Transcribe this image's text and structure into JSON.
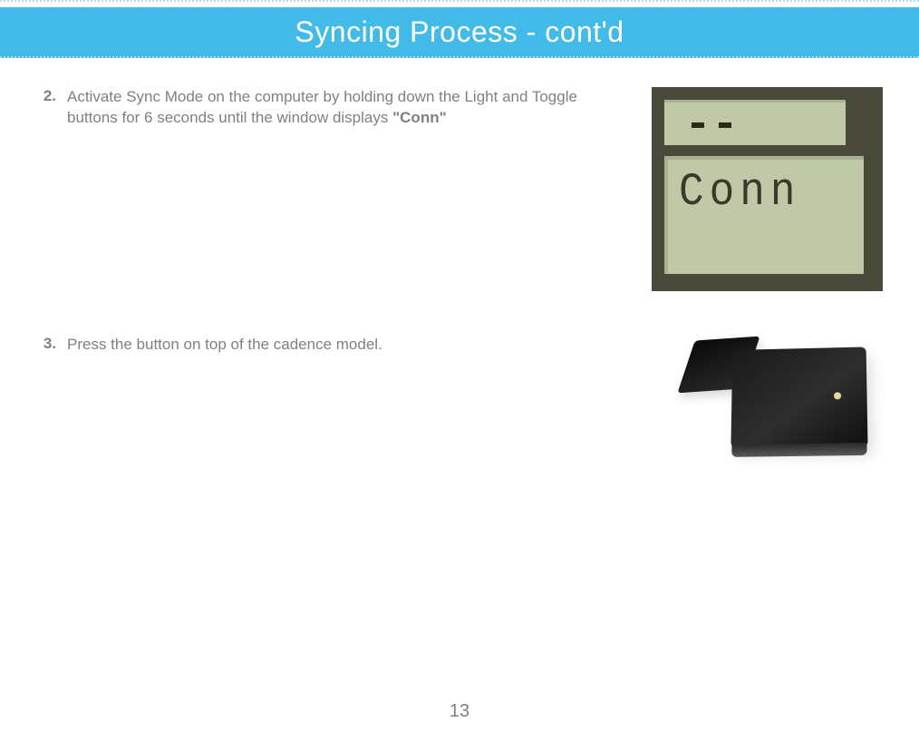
{
  "header": {
    "title": "Syncing Process - cont'd"
  },
  "steps": [
    {
      "number": "2.",
      "text_before_bold": "Activate Sync Mode on the computer by holding down the Light and Toggle buttons for 6 seconds until the window displays ",
      "bold": "\"Conn\"",
      "lcd_text": "Conn"
    },
    {
      "number": "3.",
      "text_before_bold": "Press the button on top of the cadence model.",
      "bold": ""
    }
  ],
  "page_number": "13"
}
